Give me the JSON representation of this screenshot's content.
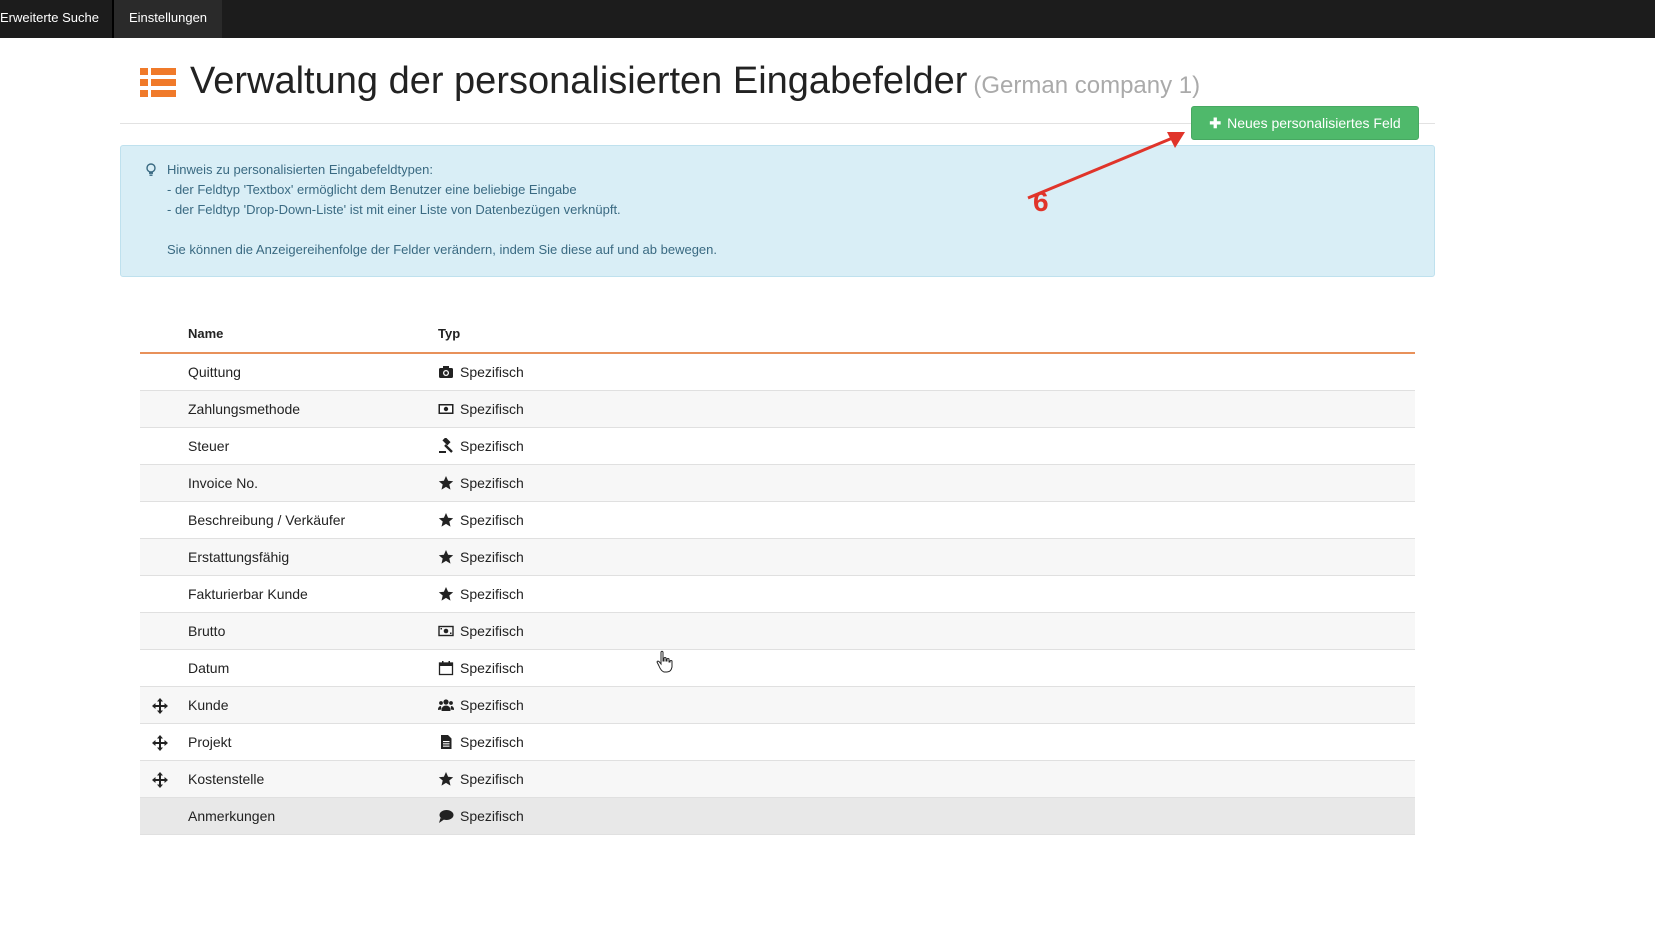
{
  "topnav": {
    "items": [
      {
        "label": "Erweiterte Suche"
      },
      {
        "label": "Einstellungen"
      }
    ]
  },
  "header": {
    "icon": "list-icon",
    "title": "Verwaltung der personalisierten Eingabefelder",
    "company": "(German company 1)",
    "accent_color": "#f07a2a"
  },
  "actions": {
    "new_field_label": "Neues personalisiertes Feld",
    "new_field_icon": "plus-icon",
    "button_color": "#4fb96b"
  },
  "info": {
    "icon": "lightbulb-icon",
    "lines": [
      "Hinweis zu personalisierten Eingabefeldtypen:",
      "- der Feldtyp 'Textbox' ermöglicht dem Benutzer eine beliebige Eingabe",
      "- der Feldtyp 'Drop-Down-Liste' ist mit einer Liste von Datenbezügen verknüpft.",
      "Sie können die Anzeigereihenfolge der Felder verändern, indem Sie diese auf und ab bewegen."
    ]
  },
  "annotation": {
    "number": "6",
    "color": "#e0342a"
  },
  "table": {
    "columns": [
      "Name",
      "Typ"
    ],
    "rows": [
      {
        "name": "Quittung",
        "type": "Spezifisch",
        "icon": "camera-icon",
        "draggable": false
      },
      {
        "name": "Zahlungsmethode",
        "type": "Spezifisch",
        "icon": "money-icon",
        "draggable": false
      },
      {
        "name": "Steuer",
        "type": "Spezifisch",
        "icon": "gavel-icon",
        "draggable": false
      },
      {
        "name": "Invoice No.",
        "type": "Spezifisch",
        "icon": "star-icon",
        "draggable": false
      },
      {
        "name": "Beschreibung / Verkäufer",
        "type": "Spezifisch",
        "icon": "star-icon",
        "draggable": false
      },
      {
        "name": "Erstattungsfähig",
        "type": "Spezifisch",
        "icon": "star-icon",
        "draggable": false
      },
      {
        "name": "Fakturierbar Kunde",
        "type": "Spezifisch",
        "icon": "star-icon",
        "draggable": false
      },
      {
        "name": "Brutto",
        "type": "Spezifisch",
        "icon": "banknote-icon",
        "draggable": false
      },
      {
        "name": "Datum",
        "type": "Spezifisch",
        "icon": "calendar-icon",
        "draggable": false
      },
      {
        "name": "Kunde",
        "type": "Spezifisch",
        "icon": "users-icon",
        "draggable": true
      },
      {
        "name": "Projekt",
        "type": "Spezifisch",
        "icon": "file-icon",
        "draggable": true
      },
      {
        "name": "Kostenstelle",
        "type": "Spezifisch",
        "icon": "star-icon",
        "draggable": true
      },
      {
        "name": "Anmerkungen",
        "type": "Spezifisch",
        "icon": "comment-icon",
        "draggable": false
      }
    ]
  }
}
